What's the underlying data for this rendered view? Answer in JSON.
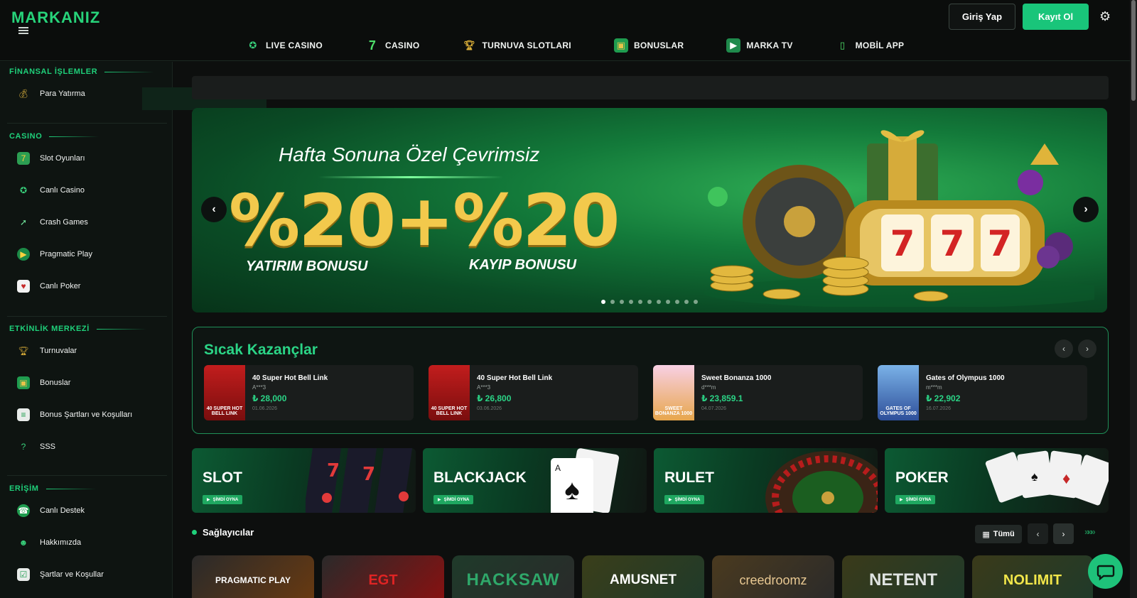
{
  "header": {
    "logo": "MARKANIZ",
    "login_label": "Giriş Yap",
    "register_label": "Kayıt Ol",
    "nav": [
      {
        "label": "LIVE CASINO",
        "icon": "roulette-chip-icon"
      },
      {
        "label": "CASINO",
        "icon": "lucky-seven-icon"
      },
      {
        "label": "TURNUVA SLOTLARI",
        "icon": "trophy-icon"
      },
      {
        "label": "BONUSLAR",
        "icon": "gift-icon"
      },
      {
        "label": "MARKA TV",
        "icon": "tv-icon"
      },
      {
        "label": "MOBİL APP",
        "icon": "phone-icon"
      }
    ]
  },
  "sidebar": {
    "sections": [
      {
        "title": "FİNANSAL İŞLEMLER",
        "items": [
          {
            "label": "Para Yatırma",
            "icon": "money-bag-icon"
          }
        ]
      },
      {
        "title": "CASINO",
        "items": [
          {
            "label": "Slot Oyunları",
            "icon": "slot-machine-icon"
          },
          {
            "label": "Canlı Casino",
            "icon": "poker-chip-icon"
          },
          {
            "label": "Crash Games",
            "icon": "rocket-icon"
          },
          {
            "label": "Pragmatic Play",
            "icon": "play-icon"
          },
          {
            "label": "Canlı Poker",
            "icon": "cards-icon"
          }
        ]
      },
      {
        "title": "ETKİNLİK MERKEZİ",
        "items": [
          {
            "label": "Turnuvalar",
            "icon": "trophy-icon"
          },
          {
            "label": "Bonuslar",
            "icon": "gift-icon"
          },
          {
            "label": "Bonus Şartları ve Koşulları",
            "icon": "document-icon"
          },
          {
            "label": "SSS",
            "icon": "faq-icon"
          }
        ]
      },
      {
        "title": "ERİŞİM",
        "items": [
          {
            "label": "Canlı Destek",
            "icon": "headset-icon"
          },
          {
            "label": "Hakkımızda",
            "icon": "people-icon"
          },
          {
            "label": "Şartlar ve Koşullar",
            "icon": "checklist-icon"
          }
        ]
      }
    ]
  },
  "banner": {
    "subtitle": "Hafta Sonuna Özel Çevrimsiz",
    "headline": "%20+%20",
    "label_left": "YATIRIM BONUSU",
    "label_right": "KAYIP BONUSU",
    "slide_count": 11,
    "active_slide": 1
  },
  "hot_wins": {
    "title": "Sıcak Kazançlar",
    "cards": [
      {
        "game": "40 Super Hot Bell Link",
        "user": "A***3",
        "amount": "₺ 28,000",
        "date": "01.06.2026",
        "thumb": "40 SUPER HOT BELL LINK"
      },
      {
        "game": "40 Super Hot Bell Link",
        "user": "A***3",
        "amount": "₺ 26,800",
        "date": "03.06.2026",
        "thumb": "40 SUPER HOT BELL LINK"
      },
      {
        "game": "Sweet Bonanza 1000",
        "user": "d***m",
        "amount": "₺ 23,859.1",
        "date": "04.07.2026",
        "thumb": "SWEET BONANZA 1000"
      },
      {
        "game": "Gates of Olympus 1000",
        "user": "m***m",
        "amount": "₺ 22,902",
        "date": "16.07.2026",
        "thumb": "GATES OF OLYMPUS 1000"
      }
    ]
  },
  "categories": [
    {
      "label": "SLOT",
      "button": "ŞİMDİ OYNA"
    },
    {
      "label": "BLACKJACK",
      "button": "ŞİMDİ OYNA"
    },
    {
      "label": "RULET",
      "button": "ŞİMDİ OYNA"
    },
    {
      "label": "POKER",
      "button": "ŞİMDİ OYNA"
    }
  ],
  "providers": {
    "title": "Sağlayıcılar",
    "all_label": "Tümü",
    "items": [
      "PRAGMATIC PLAY",
      "EGT",
      "HACKSAW",
      "AMUSNET",
      "creedroomz",
      "NETENT",
      "NOLIMIT"
    ]
  },
  "colors": {
    "accent": "#19c57a",
    "gold": "#f2c94c",
    "background": "#0d0f0e"
  }
}
